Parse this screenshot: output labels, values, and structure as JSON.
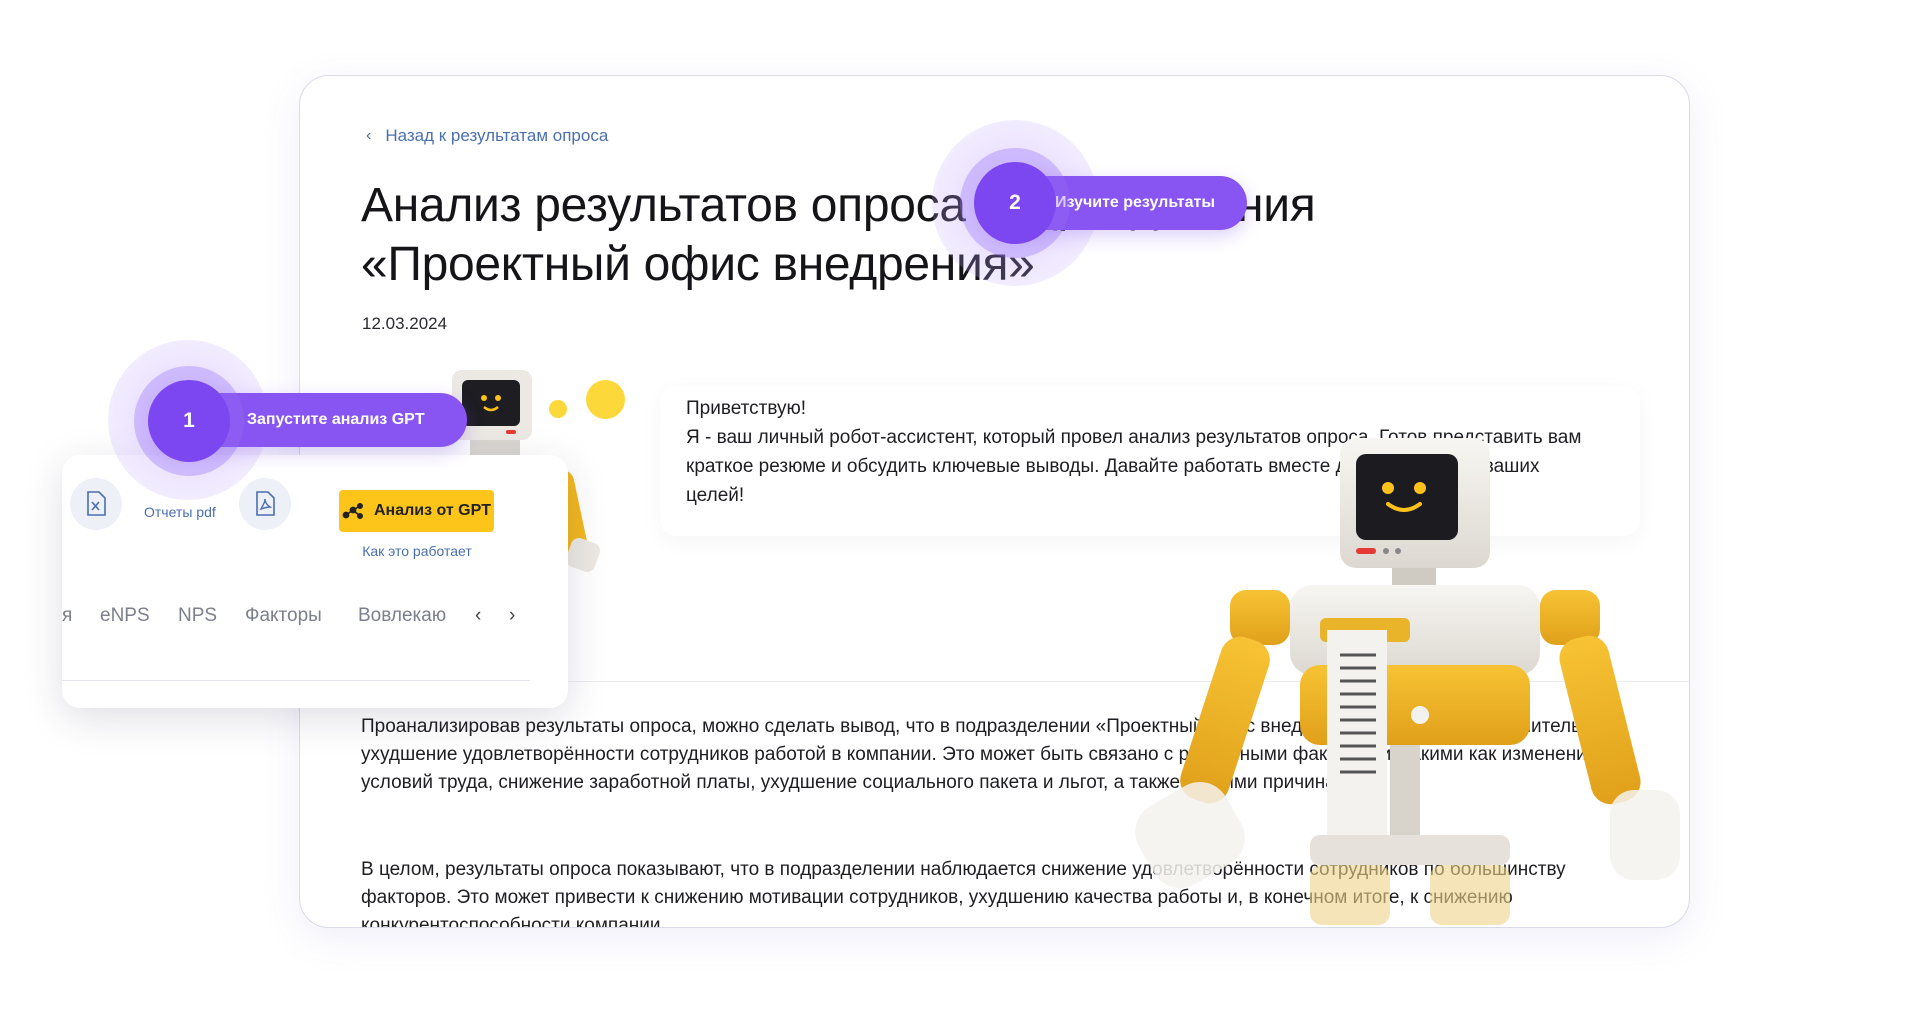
{
  "main": {
    "back_link": "Назад к результатам опроса",
    "title": "Анализ результатов опроса подразделения «Проектный офис внедрения»",
    "date": "12.03.2024",
    "greeting": "Приветствую!\nЯ - ваш личный робот-ассистент, который провел анализ результатов опроса. Готов представить вам краткое резюме и обсудить ключевые выводы. Давайте работать вместе для достижения ваших целей!",
    "paragraph_1": "Проанализировав результаты опроса, можно сделать вывод, что в подразделении «Проектный офис внедрения» наблюдается значительное ухудшение удовлетворённости сотрудников работой в компании. Это может быть связано с различными факторами, такими как изменение условий труда, снижение заработной платы, ухудшение социального пакета и льгот, а также другими причинами.",
    "paragraph_2": "В целом, результаты опроса показывают, что в подразделении наблюдается снижение удовлетворённости сотрудников по большинству факторов. Это может привести к снижению мотивации сотрудников, ухудшению качества работы и, в конечном итоге, к снижению конкурентоспособности компании."
  },
  "side_panel": {
    "pdf_label": "Отчеты pdf",
    "gpt_button": "Анализ от GPT",
    "how_link": "Как это работает",
    "tabs": [
      "я",
      "eNPS",
      "NPS",
      "Факторы",
      "Вовлекаю"
    ],
    "tab_prev": "‹",
    "tab_next": "›"
  },
  "steps": [
    {
      "number": "1",
      "label": "Запустите анализ GPT"
    },
    {
      "number": "2",
      "label": "Изучите результаты"
    }
  ],
  "colors": {
    "accent_purple": "#8955f2",
    "gpt_yellow": "#fdc51a",
    "link_blue": "#4a6fb0",
    "robot_yellow": "#f2b71f"
  }
}
